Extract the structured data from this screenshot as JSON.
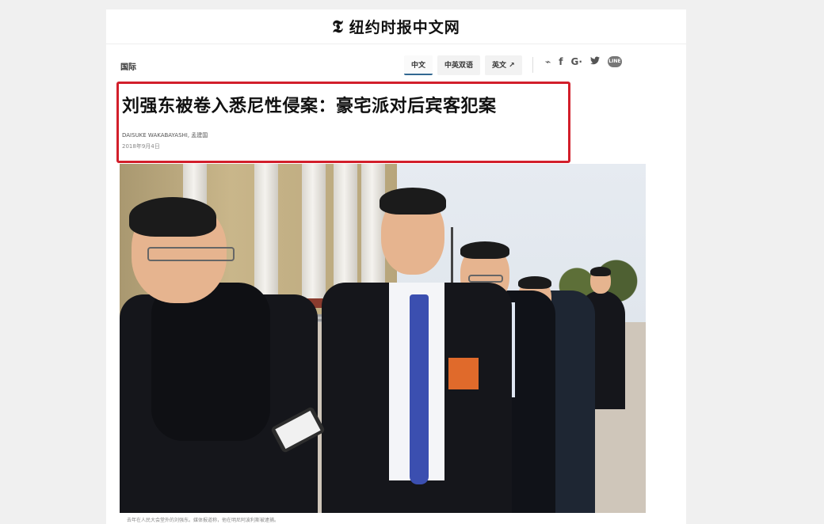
{
  "masthead": {
    "logo": "𝕿",
    "site_name": "纽约时报中文网"
  },
  "nav": {
    "section": "国际",
    "lang_tabs": [
      {
        "label": "中文",
        "active": true
      },
      {
        "label": "中英双语",
        "active": false
      },
      {
        "label": "英文 ↗",
        "active": false
      }
    ],
    "social_icons": [
      "weibo-icon",
      "facebook-icon",
      "google-plus-icon",
      "twitter-icon",
      "line-icon"
    ],
    "social_glyphs": [
      "⌁",
      "f",
      "G·",
      "🐦",
      "LINE"
    ]
  },
  "article": {
    "headline": "刘强东被卷入悉尼性侵案：豪宅派对后宾客犯案",
    "byline": "DAISUKE WAKABAYASHI, 孟建国",
    "dateline": "2018年9月4日"
  },
  "photo": {
    "caption": "去年在人民大会堂外的刘强东。媒体报道称，他在明尼阿波利斯被逮捕。"
  },
  "colors": {
    "highlight_box": "#d21f2b",
    "accent": "#326891"
  }
}
